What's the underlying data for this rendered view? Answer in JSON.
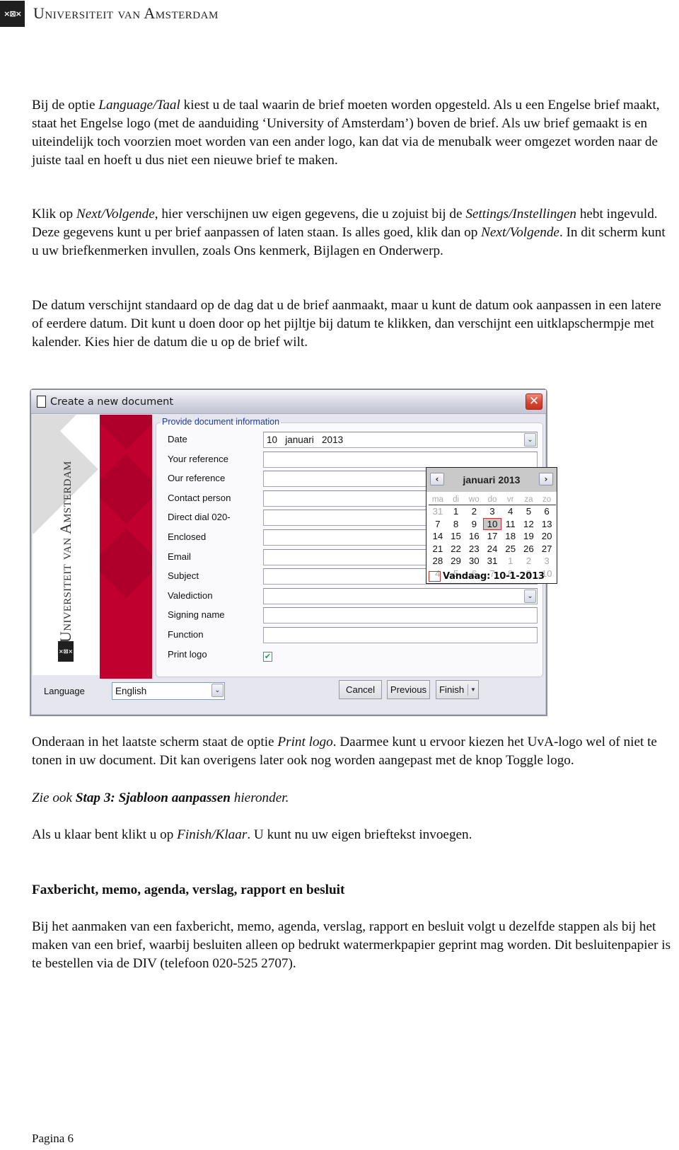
{
  "header": {
    "logo_mark": "×⊠×",
    "logo_text": "Universiteit van Amsterdam"
  },
  "paragraphs": {
    "p1": [
      {
        "t": "Bij de optie "
      },
      {
        "t": "Language/Taal",
        "i": true
      },
      {
        "t": " kiest u de taal waarin de brief moeten worden opgesteld. Als u een Engelse brief maakt, staat het Engelse logo (met de aanduiding ‘University of Amsterdam’) boven de brief. Als uw brief gemaakt is en uiteindelijk toch voorzien moet worden van een ander logo,  kan dat via de menubalk weer omgezet worden naar de juiste taal en hoeft u dus niet een nieuwe brief te maken."
      }
    ],
    "p2": [
      {
        "t": "Klik op "
      },
      {
        "t": "Next/Volgende",
        "i": true
      },
      {
        "t": ", hier verschijnen uw eigen gegevens, die u zojuist bij de "
      },
      {
        "t": "Settings/Instellingen",
        "i": true
      },
      {
        "t": " hebt ingevuld. Deze gegevens kunt u per brief aanpassen of laten staan. Is alles goed, klik dan op "
      },
      {
        "t": "Next/Volgende",
        "i": true
      },
      {
        "t": ". In dit scherm kunt u uw briefkenmerken invullen, zoals Ons kenmerk, Bijlagen en Onderwerp."
      }
    ],
    "p3": [
      {
        "t": "De datum verschijnt standaard op de dag dat u de brief aanmaakt, maar u kunt de datum ook aanpassen in een latere of eerdere datum. Dit kunt u doen door op het pijltje bij datum te klikken, dan verschijnt een uitklapschermpje met kalender. Kies hier de datum die u op de brief wilt."
      }
    ],
    "p4": [
      {
        "t": "Onderaan in het laatste scherm staat de optie "
      },
      {
        "t": "Print logo",
        "i": true
      },
      {
        "t": ". Daarmee kunt u ervoor kiezen het UvA-logo wel of niet te tonen in uw document. Dit kan overigens later ook nog worden aangepast met de knop Toggle logo."
      }
    ],
    "p5": [
      {
        "t": "Zie ook  ",
        "i": true
      },
      {
        "t": "Stap 3: Sjabloon aanpassen",
        "i": true,
        "b": true
      },
      {
        "t": " hieronder.",
        "i": true
      }
    ],
    "p6": [
      {
        "t": "Als u klaar bent klikt u op "
      },
      {
        "t": "Finish/Klaar",
        "i": true
      },
      {
        "t": ". U kunt nu uw eigen brieftekst invoegen."
      }
    ],
    "h1": [
      {
        "t": "Faxbericht, memo, agenda, verslag, rapport en besluit"
      }
    ],
    "p7": [
      {
        "t": "Bij het aanmaken van een faxbericht, memo, agenda, verslag, rapport en besluit volgt u dezelfde stappen als bij het maken van een brief, waarbij besluiten alleen op bedrukt watermerkpapier geprint mag worden. Dit besluitenpapier is te bestellen via de DIV (telefoon 020-525 2707)."
      }
    ]
  },
  "dialog": {
    "title": "Create a new document",
    "close_glyph": "✕",
    "sidebar_text": "Universiteit van Amsterdam",
    "sidebar_mark": "×⊠×",
    "group_title": "Provide document information",
    "fields": [
      {
        "label": "Date",
        "value": "10   januari   2013",
        "type": "dropdown"
      },
      {
        "label": "Your reference",
        "value": "",
        "type": "text"
      },
      {
        "label": "Our reference",
        "value": "",
        "type": "text"
      },
      {
        "label": "Contact person",
        "value": "",
        "type": "text"
      },
      {
        "label": "Direct dial 020-",
        "value": "",
        "type": "text"
      },
      {
        "label": "Enclosed",
        "value": "",
        "type": "text"
      },
      {
        "label": "Email",
        "value": "",
        "type": "text"
      },
      {
        "label": "Subject",
        "value": "",
        "type": "text"
      },
      {
        "label": "Valediction",
        "value": "",
        "type": "dropdown"
      },
      {
        "label": "Signing name",
        "value": "",
        "type": "text"
      },
      {
        "label": "Function",
        "value": "",
        "type": "text"
      },
      {
        "label": "Print logo",
        "value": "✔",
        "type": "checkbox",
        "checked": true
      }
    ],
    "dropdown_glyph": "⌄",
    "calendar": {
      "title": "januari 2013",
      "prev": "‹",
      "next": "›",
      "weekdays": [
        "ma",
        "di",
        "wo",
        "do",
        "vr",
        "za",
        "zo"
      ],
      "days": [
        {
          "d": "31",
          "m": true
        },
        {
          "d": "1"
        },
        {
          "d": "2"
        },
        {
          "d": "3"
        },
        {
          "d": "4"
        },
        {
          "d": "5"
        },
        {
          "d": "6"
        },
        {
          "d": "7"
        },
        {
          "d": "8"
        },
        {
          "d": "9"
        },
        {
          "d": "10",
          "sel": true
        },
        {
          "d": "11"
        },
        {
          "d": "12"
        },
        {
          "d": "13"
        },
        {
          "d": "14"
        },
        {
          "d": "15"
        },
        {
          "d": "16"
        },
        {
          "d": "17"
        },
        {
          "d": "18"
        },
        {
          "d": "19"
        },
        {
          "d": "20"
        },
        {
          "d": "21"
        },
        {
          "d": "22"
        },
        {
          "d": "23"
        },
        {
          "d": "24"
        },
        {
          "d": "25"
        },
        {
          "d": "26"
        },
        {
          "d": "27"
        },
        {
          "d": "28"
        },
        {
          "d": "29"
        },
        {
          "d": "30"
        },
        {
          "d": "31"
        },
        {
          "d": "1",
          "m": true
        },
        {
          "d": "2",
          "m": true
        },
        {
          "d": "3",
          "m": true
        },
        {
          "d": "4",
          "m": true
        },
        {
          "d": "5",
          "m": true
        },
        {
          "d": "6",
          "m": true
        },
        {
          "d": "7",
          "m": true
        },
        {
          "d": "8",
          "m": true
        },
        {
          "d": "9",
          "m": true
        },
        {
          "d": "10",
          "m": true
        }
      ],
      "today": "Vandaag: 10-1-2013"
    },
    "language_label": "Language",
    "language_value": "English",
    "buttons": {
      "cancel": "Cancel",
      "previous": "Previous",
      "finish": "Finish",
      "split_glyph": "▼"
    },
    "colors": {
      "red_band": "#c0002f",
      "legend_blue": "#1f3ea5",
      "selected_day_border": "#c03636",
      "check_green": "#1aa33a"
    }
  },
  "footer": {
    "page_label": "Pagina 6"
  }
}
